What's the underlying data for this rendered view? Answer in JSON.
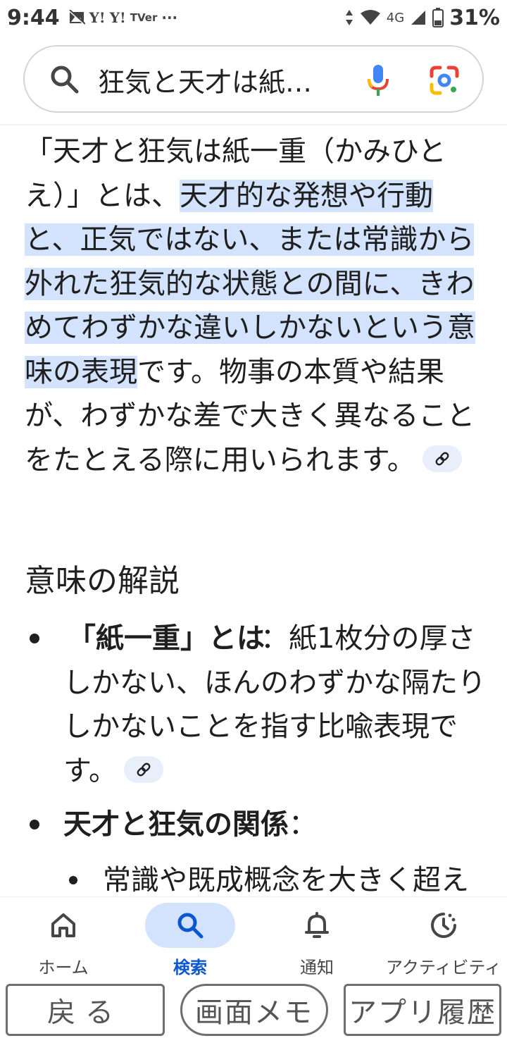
{
  "status_bar": {
    "time": "9:44",
    "left_icons": [
      "image-off-icon",
      "yahoo-icon",
      "yahoo-icon",
      "tver-icon",
      "more-dots-icon"
    ],
    "yahoo_1": "Y!",
    "yahoo_2": "Y!",
    "tver": "TVer",
    "more": "···",
    "network": "4G",
    "battery_percent": "31%"
  },
  "search": {
    "query": "狂気と天才は紙…"
  },
  "article": {
    "para_before": "「天才と狂気は紙一重（かみひとえ）」とは、",
    "para_highlight": "天才的な発想や行動と、正気ではない、または常識から外れた狂気的な状態との間に、きわめてわずかな違いしかないという意味の表現",
    "para_after": "です。物事の本質や結果が、わずかな差で大きく異なることをたとえる際に用いられます。",
    "section_title": "意味の解説",
    "bullet1_bold": "「紙一重」とは",
    "bullet1_text": "：紙1枚分の厚さしかない、ほんのわずかな隔たりしかないことを指す比喩表現です。",
    "bullet2_bold": "天才と狂気の関係",
    "bullet2_colon": "：",
    "sub_bullet1": "常識や既成概念を大きく超え"
  },
  "bottom_nav": {
    "items": [
      {
        "label": "ホーム",
        "icon": "home-icon"
      },
      {
        "label": "検索",
        "icon": "search-icon",
        "active": true
      },
      {
        "label": "通知",
        "icon": "bell-icon"
      },
      {
        "label": "アクティビティ",
        "icon": "activity-icon"
      }
    ]
  },
  "system_buttons": {
    "back": "戻る",
    "memo": "画面メモ",
    "history": "アプリ履歴"
  },
  "colors": {
    "highlight": "#d3e3fd",
    "active_nav": "#0b57d0",
    "active_pill": "#d3e3fd"
  }
}
